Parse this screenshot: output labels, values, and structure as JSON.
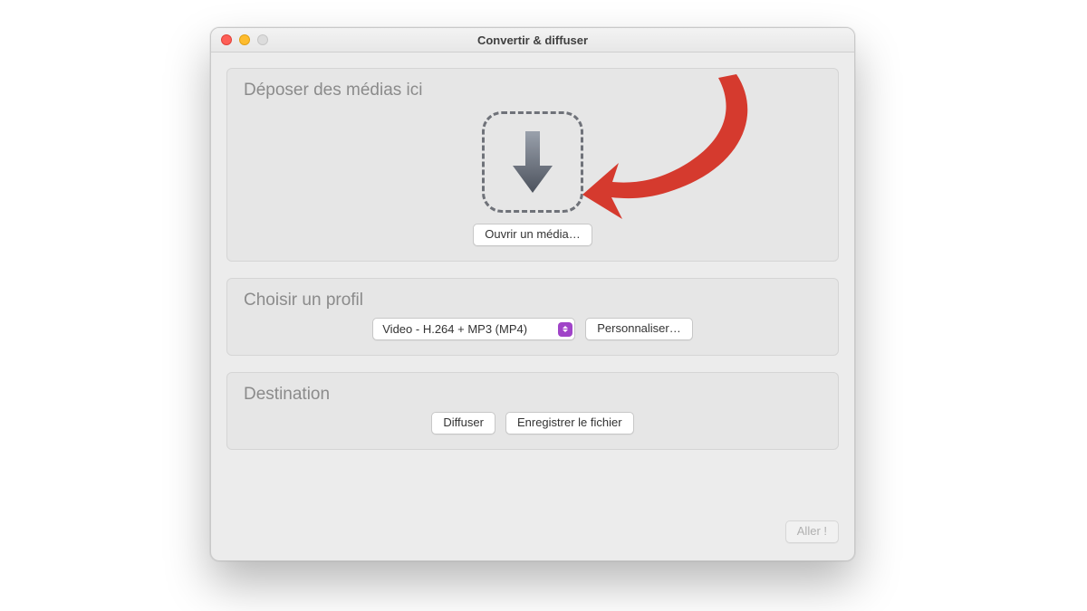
{
  "window": {
    "title": "Convertir & diffuser"
  },
  "drop": {
    "heading": "Déposer des médias ici",
    "open_label": "Ouvrir un média…"
  },
  "profile": {
    "heading": "Choisir un profil",
    "selected": "Video - H.264 + MP3 (MP4)",
    "customize_label": "Personnaliser…"
  },
  "destination": {
    "heading": "Destination",
    "stream_label": "Diffuser",
    "save_label": "Enregistrer le fichier"
  },
  "footer": {
    "go_label": "Aller !"
  }
}
